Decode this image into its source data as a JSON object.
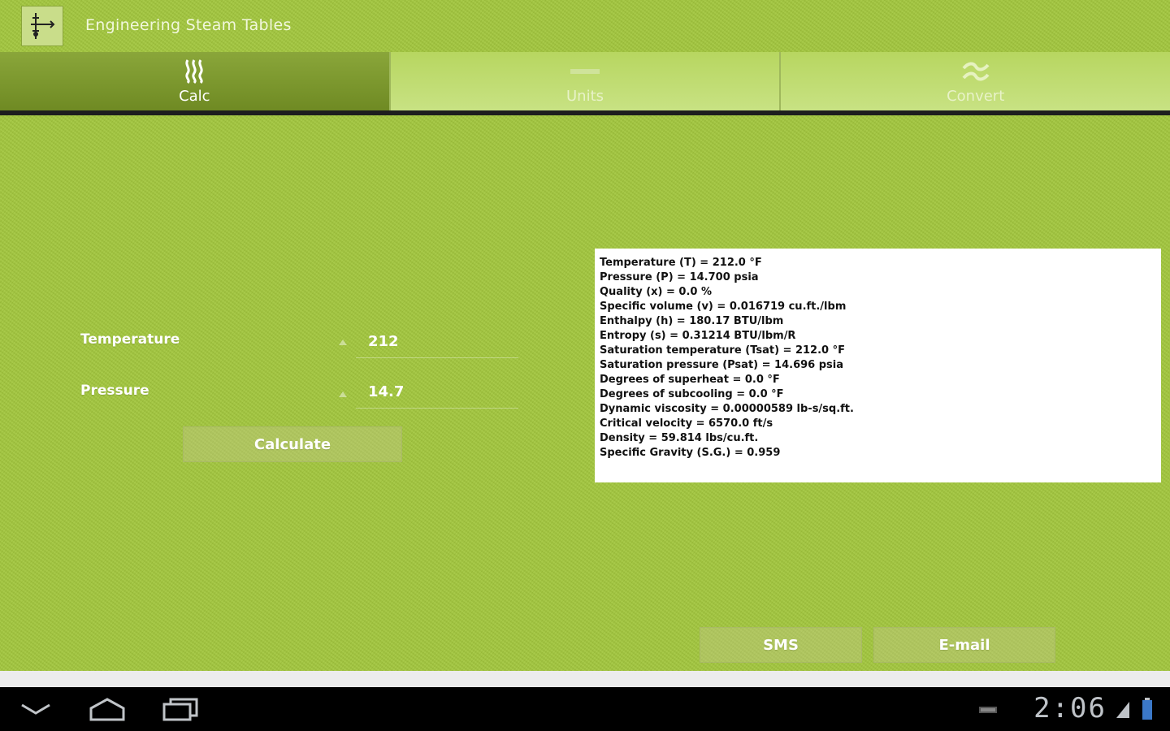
{
  "app": {
    "title": "Engineering Steam Tables",
    "icon": "steam-app-icon"
  },
  "tabs": [
    {
      "label": "Calc",
      "icon": "steam-icon",
      "active": true
    },
    {
      "label": "Units",
      "icon": "units-bar-icon",
      "active": false
    },
    {
      "label": "Convert",
      "icon": "approx-icon",
      "active": false
    }
  ],
  "form": {
    "temperature_label": "Temperature",
    "temperature_value": "212",
    "pressure_label": "Pressure",
    "pressure_value": "14.7",
    "calculate_label": "Calculate"
  },
  "results": [
    "Temperature (T) = 212.0 °F",
    "Pressure (P) = 14.700 psia",
    "Quality (x) = 0.0 %",
    "Specific volume (v) = 0.016719 cu.ft./lbm",
    "Enthalpy (h) = 180.17 BTU/lbm",
    "Entropy (s) = 0.31214 BTU/lbm/R",
    "Saturation temperature (Tsat) = 212.0 °F",
    "Saturation pressure (Psat) = 14.696 psia",
    "Degrees of superheat = 0.0 °F",
    "Degrees of subcooling = 0.0 °F",
    "Dynamic viscosity = 0.00000589 lb-s/sq.ft.",
    "Critical velocity = 6570.0 ft/s",
    "Density = 59.814 lbs/cu.ft.",
    "Specific Gravity (S.G.) = 0.959"
  ],
  "share": {
    "sms_label": "SMS",
    "email_label": "E-mail"
  },
  "system": {
    "clock": "2:06"
  },
  "colors": {
    "background": "#a2c63d",
    "active_tab": "#7a9630",
    "nav_bar": "#000000"
  }
}
